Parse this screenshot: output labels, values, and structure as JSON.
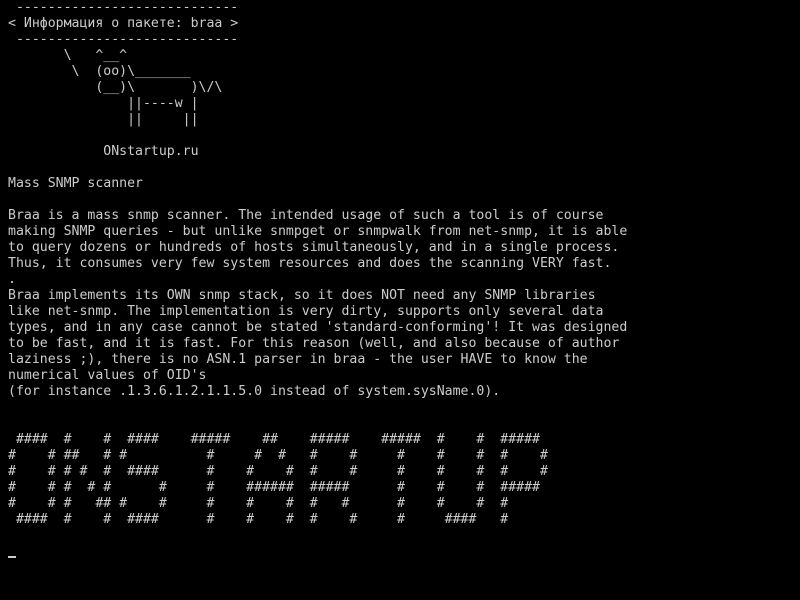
{
  "terminal": {
    "lines": [
      " ----------------------------",
      "< Информация о пакете: braa >",
      " ----------------------------",
      "       \\   ^__^",
      "        \\  (oo)\\_______",
      "           (__)\\       )\\/\\",
      "               ||----w |",
      "               ||     ||",
      "",
      "            ONstartup.ru",
      "",
      "Mass SNMP scanner",
      "",
      "Braa is a mass snmp scanner. The intended usage of such a tool is of course",
      "making SNMP queries - but unlike snmpget or snmpwalk from net-snmp, it is able",
      "to query dozens or hundreds of hosts simultaneously, and in a single process.",
      "Thus, it consumes very few system resources and does the scanning VERY fast.",
      ".",
      "Braa implements its OWN snmp stack, so it does NOT need any SNMP libraries",
      "like net-snmp. The implementation is very dirty, supports only several data",
      "types, and in any case cannot be stated 'standard-conforming'! It was designed",
      "to be fast, and it is fast. For this reason (well, and also because of author",
      "laziness ;), there is no ASN.1 parser in braa - the user HAVE to know the",
      "numerical values of OID's",
      "(for instance .1.3.6.1.2.1.1.5.0 instead of system.sysName.0).",
      "",
      "",
      " ####  #    #  ####    #####    ##    #####    #####  #    #  #####",
      "#    # ##   # #          #     #  #   #    #     #    #    #  #    #",
      "#    # # #  #  ####      #    #    #  #    #     #    #    #  #    #",
      "#    # #  # #      #     #    ######  #####      #    #    #  #####",
      "#    # #   ## #    #     #    #    #  #   #      #    #    #  #",
      " ####  #    #  ####      #    #    #  #    #     #     ####   #",
      "",
      ""
    ]
  }
}
